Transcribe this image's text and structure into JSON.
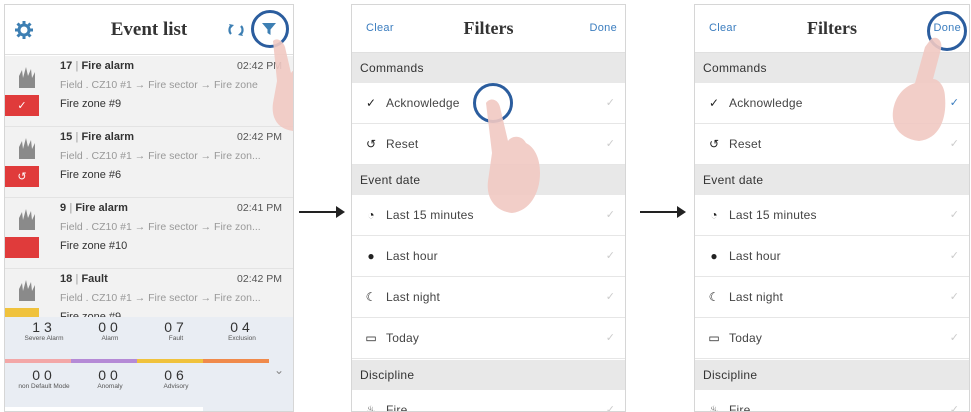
{
  "event_list": {
    "title": "Event list",
    "events": [
      {
        "id": "17",
        "type": "Fire alarm",
        "time": "02:42 PM",
        "path": "Field . CZ10 #1 → Fire sector → Fire zone",
        "zone": "Fire zone #9",
        "state_color": "#e03b3b",
        "state_icon": "✓"
      },
      {
        "id": "15",
        "type": "Fire alarm",
        "time": "02:42 PM",
        "path": "Field . CZ10 #1 → Fire sector → Fire zon...",
        "zone": "Fire zone #6",
        "state_color": "#e03b3b",
        "state_icon": "↺"
      },
      {
        "id": "9",
        "type": "Fire alarm",
        "time": "02:41 PM",
        "path": "Field . CZ10 #1 → Fire sector → Fire zon...",
        "zone": "Fire zone #10",
        "state_color": "#e03b3b",
        "state_icon": ""
      },
      {
        "id": "18",
        "type": "Fault",
        "time": "02:42 PM",
        "path": "Field . CZ10 #1 → Fire sector → Fire zon...",
        "zone": "Fire zone #9",
        "state_color": "#f0c23c",
        "state_icon": ""
      }
    ],
    "summary": [
      {
        "count": "13",
        "label": "Severe Alarm",
        "color": "#f3a7a7"
      },
      {
        "count": "00",
        "label": "Alarm",
        "color": "#b58ad6"
      },
      {
        "count": "07",
        "label": "Fault",
        "color": "#f0c23c"
      },
      {
        "count": "04",
        "label": "Exclusion",
        "color": "#f08a4b"
      },
      {
        "count": "00",
        "label": "non Default Mode",
        "color": "#ffffff"
      },
      {
        "count": "00",
        "label": "Anomaly",
        "color": "#ffffff"
      },
      {
        "count": "06",
        "label": "Advisory",
        "color": "#ffffff"
      }
    ]
  },
  "filters": {
    "clear_label": "Clear",
    "title": "Filters",
    "done_label": "Done",
    "sections": {
      "commands": "Commands",
      "event_date": "Event date",
      "discipline": "Discipline"
    },
    "commands": [
      {
        "label": "Acknowledge",
        "icon": "✓"
      },
      {
        "label": "Reset",
        "icon": "↺"
      }
    ],
    "dates": [
      {
        "label": "Last 15 minutes",
        "icon": "◔"
      },
      {
        "label": "Last hour",
        "icon": "●"
      },
      {
        "label": "Last night",
        "icon": "☾"
      },
      {
        "label": "Today",
        "icon": "▭"
      }
    ],
    "disciplines": [
      {
        "label": "Fire"
      }
    ]
  },
  "colors": {
    "accent": "#3b7dbf",
    "highlight_circle": "#2b5d9e",
    "section_bg": "#e8e8e8"
  }
}
